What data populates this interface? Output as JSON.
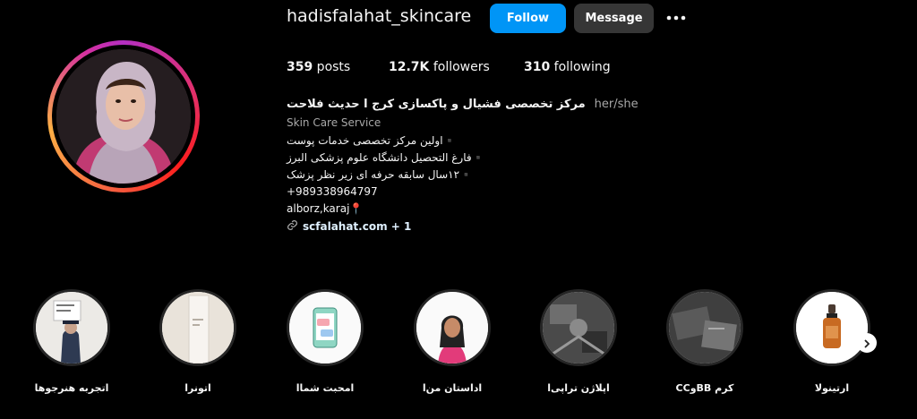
{
  "header": {
    "username": "hadisfalahat_skincare",
    "follow_label": "Follow",
    "message_label": "Message"
  },
  "stats": {
    "posts_count": "359",
    "posts_label": " posts",
    "followers_count": "12.7K",
    "followers_label": " followers",
    "following_count": "310",
    "following_label": " following"
  },
  "bio": {
    "full_name": "مرکز تخصصی فشیال و پاکسازی کرج ا حدیث فلاحت",
    "pronouns": "her/she",
    "category": "Skin Care Service",
    "lines": [
      "▪️اولین مرکز تخصصی خدمات پوست",
      "▪️فارغ التحصیل دانشگاه علوم پزشکی البرز",
      "▪️۱۲سال سابقه حرفه ای زیر نظر پزشک",
      "+989338964797"
    ],
    "location": "alborz,karaj",
    "location_emoji": "📍",
    "link": "scfalahat.com + 1"
  },
  "highlights": [
    {
      "label": "اتجربه هنرجوها"
    },
    {
      "label": "اتونرا"
    },
    {
      "label": "امحبت شماا"
    },
    {
      "label": "اداستان من‌ا"
    },
    {
      "label": "اپلاژن تراپی‌ا"
    },
    {
      "label": "کرم BBوCC"
    },
    {
      "label": "ارتینولا"
    }
  ],
  "colors": {
    "follow_button": "#0095f6",
    "message_button": "#363636",
    "background": "#000000"
  },
  "icons": {
    "more": "more-horizontal-icon",
    "link": "link-icon",
    "next": "chevron-right-icon"
  }
}
